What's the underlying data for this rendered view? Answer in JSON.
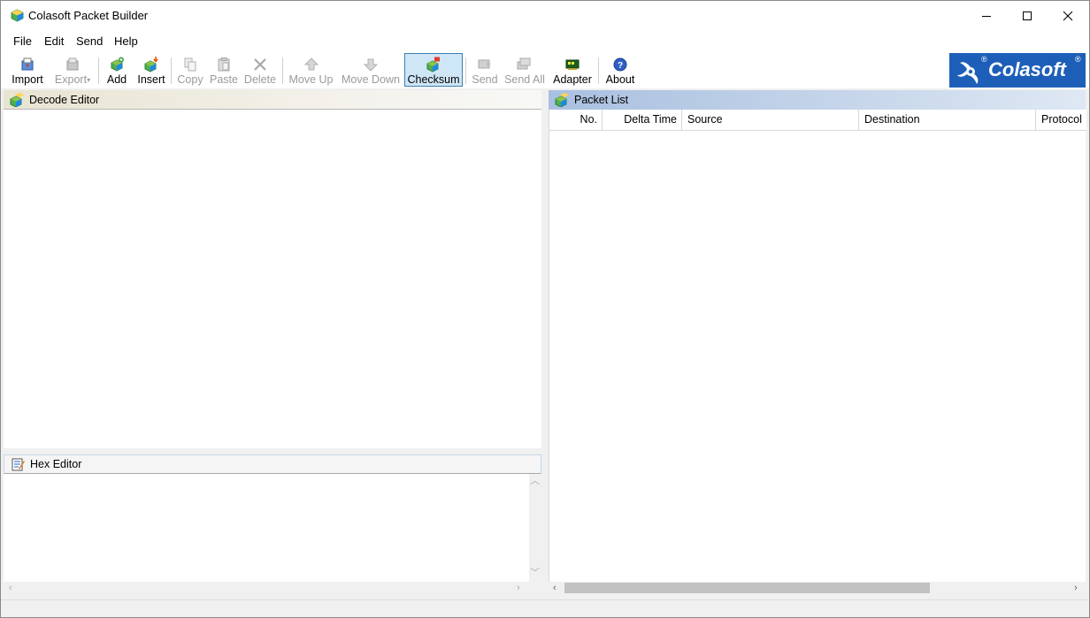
{
  "window": {
    "title": "Colasoft Packet Builder"
  },
  "menu": [
    "File",
    "Edit",
    "Send",
    "Help"
  ],
  "toolbar": {
    "import": "Import",
    "export": "Export",
    "add": "Add",
    "insert": "Insert",
    "copy": "Copy",
    "paste": "Paste",
    "delete": "Delete",
    "move_up": "Move Up",
    "move_down": "Move Down",
    "checksum": "Checksum",
    "send": "Send",
    "send_all": "Send All",
    "adapter": "Adapter",
    "about": "About"
  },
  "logo": {
    "text": "Colasoft",
    "reg": "®",
    "color": "#1d5fb8"
  },
  "panels": {
    "decode_editor": "Decode Editor",
    "hex_editor": "Hex Editor",
    "packet_list": "Packet List"
  },
  "packet_list": {
    "columns": [
      "No.",
      "Delta Time",
      "Source",
      "Destination",
      "Protocol"
    ],
    "rows": []
  },
  "colors": {
    "active_button_bg": "#cfe6f7",
    "active_button_border": "#3c7fb1",
    "disabled_text": "#9a9a9a"
  }
}
